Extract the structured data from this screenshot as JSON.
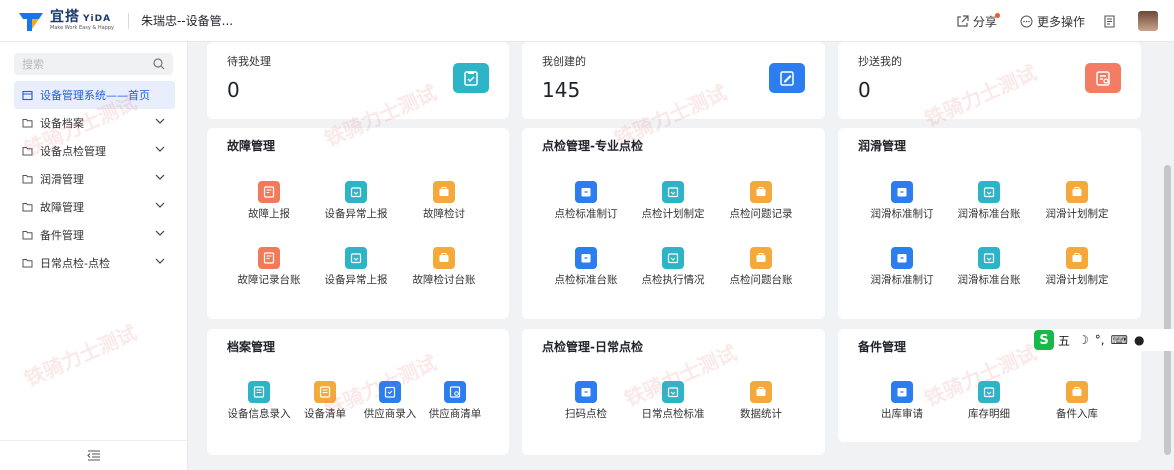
{
  "header": {
    "logo_name": "宜搭",
    "logo_en": "YiDA",
    "logo_slogan": "Make Work Easy & Happy",
    "app_title": "朱瑞忠--设备管...",
    "share_label": "分享",
    "more_label": "更多操作"
  },
  "sidebar": {
    "search_placeholder": "搜索",
    "items": [
      {
        "label": "设备管理系统——首页",
        "active": true
      },
      {
        "label": "设备档案"
      },
      {
        "label": "设备点检管理"
      },
      {
        "label": "润滑管理"
      },
      {
        "label": "故障管理"
      },
      {
        "label": "备件管理"
      },
      {
        "label": "日常点检-点检"
      }
    ]
  },
  "stats": [
    {
      "label": "待我处理",
      "value": "0",
      "icon": "clipboard-check-icon",
      "color": "#2db5c7"
    },
    {
      "label": "我创建的",
      "value": "145",
      "icon": "edit-doc-icon",
      "color": "#2c7ef0"
    },
    {
      "label": "抄送我的",
      "value": "0",
      "icon": "cc-doc-icon",
      "color": "#f47c64"
    }
  ],
  "sections": {
    "fault": {
      "title": "故障管理",
      "items": [
        "故障上报",
        "设备异常上报",
        "故障检讨",
        "故障记录台账",
        "设备异常上报",
        "故障检讨台账"
      ]
    },
    "inspect_pro": {
      "title": "点检管理-专业点检",
      "items": [
        "点检标准制订",
        "点检计划制定",
        "点检问题记录",
        "点检标准台账",
        "点检执行情况",
        "点检问题台账"
      ]
    },
    "lube": {
      "title": "润滑管理",
      "items": [
        "润滑标准制订",
        "润滑标准台账",
        "润滑计划制定",
        "润滑标准制订",
        "润滑标准台账",
        "润滑计划制定"
      ]
    },
    "archive": {
      "title": "档案管理",
      "items": [
        "设备信息录入",
        "设备清单",
        "供应商录入",
        "供应商清单"
      ]
    },
    "inspect_daily": {
      "title": "点检管理-日常点检",
      "items": [
        "扫码点检",
        "日常点检标准",
        "数据统计"
      ]
    },
    "spare": {
      "title": "备件管理",
      "items": [
        "出库审请",
        "库存明细",
        "备件入库"
      ]
    }
  },
  "watermark": "铁骑力士测试",
  "ime": {
    "logo": "S",
    "text": "五"
  }
}
